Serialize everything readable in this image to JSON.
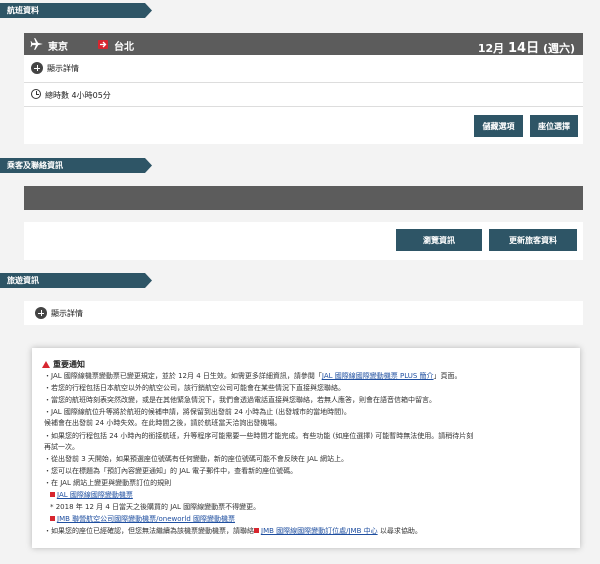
{
  "flight_section": {
    "tab": "航班資料",
    "from": "東京",
    "to": "台北",
    "date_month": "12月",
    "date_day": "14日",
    "date_weekday": "(週六)",
    "show_details": "顯示詳情",
    "total_time": "總時數 4小時05分",
    "btn_seat_options": "儲藏選項",
    "btn_seat_select": "座位選擇"
  },
  "passenger_section": {
    "tab": "乘客及聯絡資訊",
    "btn_view": "瀏覽資訊",
    "btn_update": "更新旅客資料"
  },
  "travel_section": {
    "tab": "旅遊資訊",
    "show_details": "顯示詳情"
  },
  "notice": {
    "title": "重要通知",
    "lines": [
      "・JAL 國際線機票變動票已變更規定，並於 12月 4 日生效。如需更多詳細資訊，請參閱「",
      "・若您的行程包括日本航空以外的航空公司，該行銷航空公司可能會在某些情況下直接與您聯絡。",
      "・當您的航班時刻表突然改變，或是在其他緊急情況下，我們會透過電話直接與您聯絡，若無人應答，則會在語音信箱中留言。",
      "・JAL 國際線航位升等將於航班的候補申請，將保留到出發前 24 小時為止 (出發城市的當地時間)。",
      "  候補會在出發前 24 小時失效。在此時間之後，請於航班當天洽詢出發機場。",
      "・如果您的行程包括 24 小時內的銜接航班，升等程序可能需要一些時間才能完成。有些功能 (如座位選擇) 可能暫時無法使用。請稍待片刻",
      "  再試一次。",
      "・從出發前 3 天開始，如果預選座位號碼有任何變動，新的座位號碼可能不會反映在 JAL 網站上。",
      "・您可以在標題為「預訂內容變更通知」的 JAL 電子郵件中，查看新的座位號碼。",
      "・在 JAL 網站上變更與變動票訂位的規則",
      "* 2018 年 12 月 4 日當天之後購買的 JAL 國際線變動票不得變更。",
      "・如果您的座位已經確認，但您無法繼續為該機票變動機票，請聯絡"
    ],
    "link_plus": "JAL 國際線國際變動機票 PLUS 簡介",
    "line0_tail": "」頁面。",
    "link_jal_change": "JAL 國際線國際變動機票",
    "link_jmb": "JMB 聯營航空公司國際變動機票/oneworld 國際變動機票",
    "link_jmb_center": "JMB 國際線國際變動訂位處/JMB 中心",
    "line_last_tail": " 以尋求協助。"
  }
}
